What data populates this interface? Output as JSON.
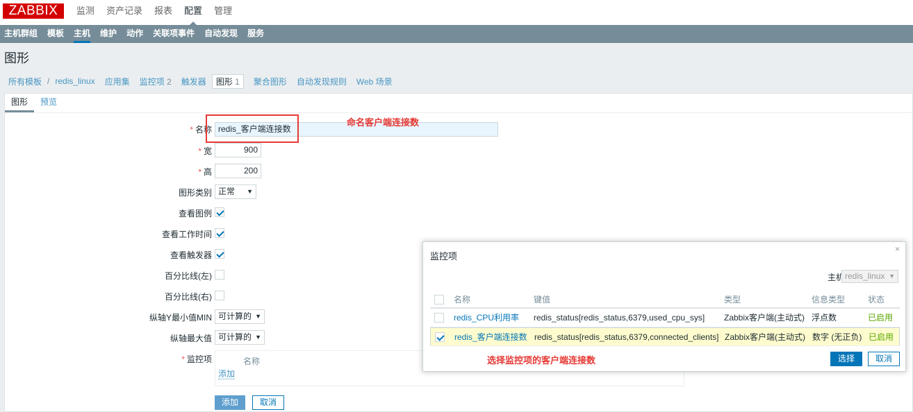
{
  "app": {
    "logo": "ZABBIX"
  },
  "main_menu": [
    {
      "label": "监测",
      "active": false
    },
    {
      "label": "资产记录",
      "active": false
    },
    {
      "label": "报表",
      "active": false
    },
    {
      "label": "配置",
      "active": true
    },
    {
      "label": "管理",
      "active": false
    }
  ],
  "sub_menu": [
    {
      "label": "主机群组",
      "active": false
    },
    {
      "label": "模板",
      "active": false
    },
    {
      "label": "主机",
      "active": true
    },
    {
      "label": "维护",
      "active": false
    },
    {
      "label": "动作",
      "active": false
    },
    {
      "label": "关联项事件",
      "active": false
    },
    {
      "label": "自动发现",
      "active": false
    },
    {
      "label": "服务",
      "active": false
    }
  ],
  "page_title": "图形",
  "breadcrumb": {
    "all_templates": "所有模板",
    "separator": "/",
    "host": "redis_linux",
    "applications": "应用集",
    "items": "监控项",
    "items_count": "2",
    "triggers": "触发器",
    "graphs": "图形",
    "graphs_count": "1",
    "screens": "聚合图形",
    "discovery": "自动发现规则",
    "web": "Web 场景"
  },
  "tabs": {
    "graph": "图形",
    "preview": "预览"
  },
  "form": {
    "name_label": "名称",
    "name_value": "redis_客户端连接数",
    "width_label": "宽",
    "width_value": "900",
    "height_label": "高",
    "height_value": "200",
    "graph_type_label": "图形类别",
    "graph_type_value": "正常",
    "show_legend_label": "查看图例",
    "show_legend": true,
    "show_working_time_label": "查看工作时间",
    "show_working_time": true,
    "show_triggers_label": "查看触发器",
    "show_triggers": true,
    "percentile_left_label": "百分比线(左)",
    "percentile_left": false,
    "percentile_right_label": "百分比线(右)",
    "percentile_right": false,
    "ymin_label": "纵轴Y最小值MIN",
    "ymin_value": "可计算的",
    "ymax_label": "纵轴最大值",
    "ymax_value": "可计算的",
    "items_label": "监控项",
    "items_col_name": "名称",
    "add_link": "添加",
    "add_button": "添加",
    "cancel_button": "取消"
  },
  "annotations": {
    "name_note": "命名客户端连接数",
    "select_note": "选择监控项的客户端连接数",
    "color": "#e53935"
  },
  "modal": {
    "title": "监控项",
    "close": "×",
    "host_label": "主机",
    "host_value": "redis_linux",
    "columns": {
      "name": "名称",
      "key": "键值",
      "type": "类型",
      "info_type": "信息类型",
      "status": "状态"
    },
    "rows": [
      {
        "checked": false,
        "name": "redis_CPU利用率",
        "key": "redis_status[redis_status,6379,used_cpu_sys]",
        "type": "Zabbix客户端(主动式)",
        "info_type": "浮点数",
        "status": "已启用"
      },
      {
        "checked": true,
        "name": "redis_客户端连接数",
        "key": "redis_status[redis_status,6379,connected_clients]",
        "type": "Zabbix客户端(主动式)",
        "info_type": "数字 (无正负)",
        "status": "已启用"
      }
    ],
    "select_button": "选择",
    "cancel_button": "取消"
  }
}
